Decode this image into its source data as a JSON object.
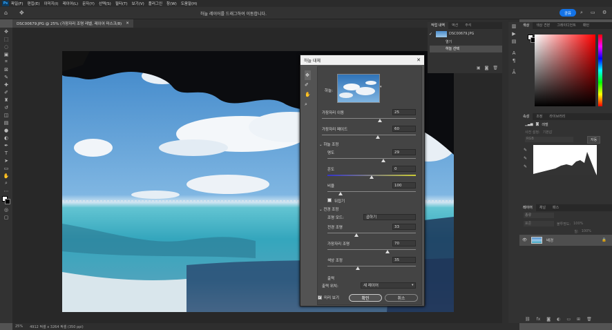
{
  "menu": {
    "items": [
      "파일(F)",
      "편집(E)",
      "이미지(I)",
      "레이어(L)",
      "문자(Y)",
      "선택(S)",
      "필터(T)",
      "보기(V)",
      "플러그인",
      "창(W)",
      "도움말(H)"
    ]
  },
  "options": {
    "hint": "하늘 레이어를 드래그하여 이동합니다.",
    "share": "공유"
  },
  "document": {
    "tab": "DSC00679.JPG @ 25% (가장자리 조명 레벨, 레이어 마스크/8)",
    "zoom": "25%",
    "info": "4912 픽셀 x 3264 픽셀 (350 ppi)"
  },
  "history": {
    "tabs": [
      "작업 내역",
      "액션",
      "주석"
    ],
    "file": "DSC00679.JPG",
    "items": [
      "열기",
      "하늘 선택"
    ]
  },
  "color": {
    "tabs": [
      "색상",
      "색상 견본",
      "그레이디언트",
      "패턴"
    ]
  },
  "properties": {
    "tabs": [
      "속성",
      "조정",
      "라이브러리"
    ],
    "kind": "레벨",
    "preset_label": "사전 설정:",
    "preset": "기본값",
    "channel": "RGB",
    "auto": "자동"
  },
  "layers": {
    "tabs": [
      "레이어",
      "채널",
      "패스"
    ],
    "search": "종류",
    "blend": "표준",
    "opacity_label": "불투명도:",
    "opacity": "100%",
    "fill_label": "칠:",
    "fill": "100%",
    "layer_name": "배경"
  },
  "dialog": {
    "title": "하늘 대체",
    "sky_label": "하늘:",
    "shift_edge": {
      "label": "가장자리 이동",
      "value": "25"
    },
    "fade_edge": {
      "label": "가장자리 페이드",
      "value": "60"
    },
    "sky_adjust": "하늘 조정",
    "brightness": {
      "label": "명도",
      "value": "29"
    },
    "temperature": {
      "label": "온도",
      "value": "0"
    },
    "scale": {
      "label": "비율",
      "value": "100"
    },
    "flip": "뒤집기",
    "fg_adjust": "전경 조정",
    "light_mode": {
      "label": "조명 모드:",
      "value": "곱하기"
    },
    "fg_light": {
      "label": "전경 조명",
      "value": "33"
    },
    "edge_light": {
      "label": "가장자리 조명",
      "value": "70"
    },
    "color_adjust": {
      "label": "색상 조정",
      "value": "35"
    },
    "output": "출력",
    "output_to": {
      "label": "출력 위치:",
      "value": "새 레이어"
    },
    "preview": "미리 보기",
    "ok": "확인",
    "cancel": "취소"
  }
}
